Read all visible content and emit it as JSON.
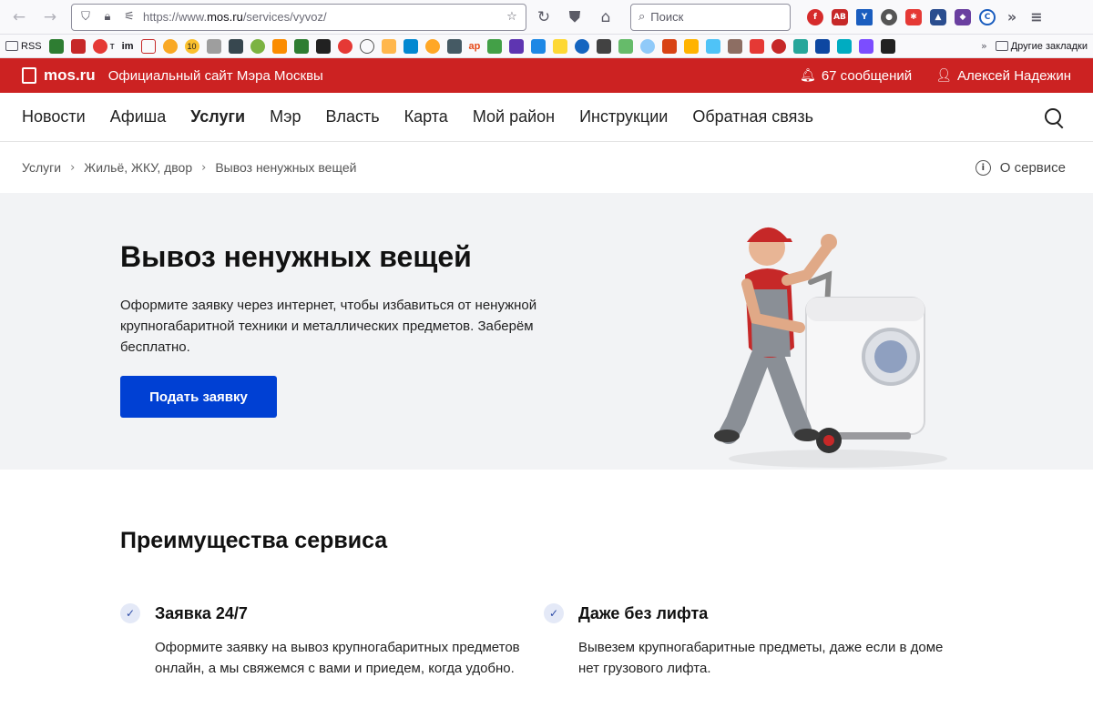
{
  "browser": {
    "url_prefix": "https://www.",
    "url_domain": "mos.ru",
    "url_path": "/services/vyvoz/",
    "search_placeholder": "Поиск",
    "icons": [
      "back-arrow-icon",
      "forward-arrow-icon",
      "shield-icon",
      "lock-icon",
      "permissions-icon",
      "star-icon",
      "reload-icon",
      "pocket-icon",
      "home-icon",
      "search-icon"
    ]
  },
  "bookmarks": {
    "rss_label": "RSS",
    "t_label": "т",
    "im_label": "im",
    "ten_label": "10",
    "ap_label": "ap",
    "other_label": "Другие закладки"
  },
  "site_header": {
    "logo_text": "mos.ru",
    "site_title": "Официальный сайт Мэра Москвы",
    "messages": "67 сообщений",
    "user_name": "Алексей Надежин",
    "brand_color": "#cc2222"
  },
  "nav": {
    "items": [
      "Новости",
      "Афиша",
      "Услуги",
      "Мэр",
      "Власть",
      "Карта",
      "Мой район",
      "Инструкции",
      "Обратная связь"
    ],
    "active_index": 2
  },
  "breadcrumb": {
    "items": [
      "Услуги",
      "Жильё, ЖКУ, двор",
      "Вывоз ненужных вещей"
    ],
    "about_label": "О сервисе"
  },
  "hero": {
    "title": "Вывоз ненужных вещей",
    "description": "Оформите заявку через интернет, чтобы избавиться от ненужной крупногабаритной техники и металлических предметов. Заберём бесплатно.",
    "cta_label": "Подать заявку",
    "cta_color": "#0040d3"
  },
  "advantages": {
    "heading": "Преимущества сервиса",
    "items": [
      {
        "title": "Заявка 24/7",
        "text": "Оформите заявку на вывоз крупногабаритных предметов онлайн, а мы свяжемся с вами и приедем, когда удобно."
      },
      {
        "title": "Даже без лифта",
        "text": "Вывезем крупногабаритные предметы, даже если в доме нет грузового лифта."
      }
    ]
  }
}
